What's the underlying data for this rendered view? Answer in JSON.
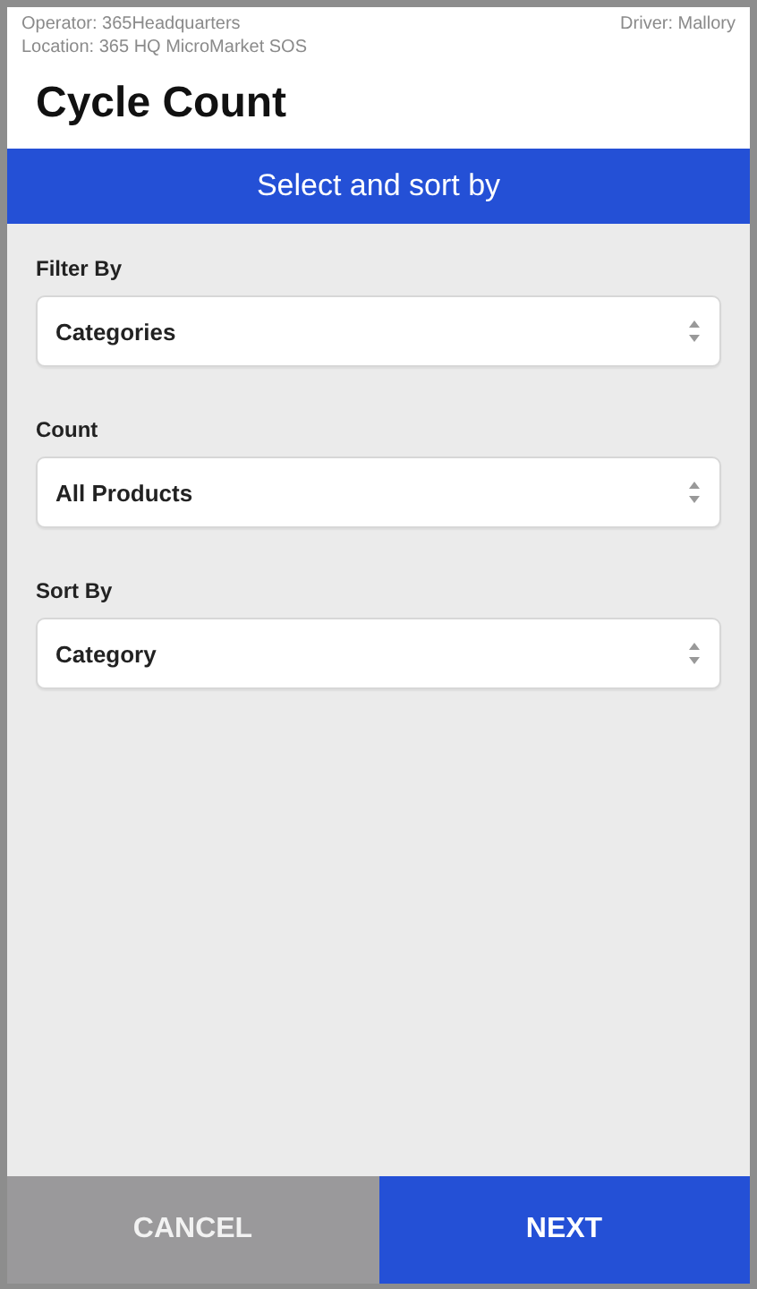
{
  "header": {
    "operator": "Operator: 365Headquarters",
    "driver": "Driver: Mallory",
    "location": "Location: 365 HQ MicroMarket SOS",
    "title": "Cycle Count"
  },
  "banner": "Select and sort by",
  "fields": [
    {
      "label": "Filter By",
      "value": "Categories"
    },
    {
      "label": "Count",
      "value": "All Products"
    },
    {
      "label": "Sort By",
      "value": "Category"
    }
  ],
  "buttons": [
    {
      "label": "CANCEL",
      "kind": "secondary"
    },
    {
      "label": "NEXT",
      "kind": "primary"
    }
  ]
}
